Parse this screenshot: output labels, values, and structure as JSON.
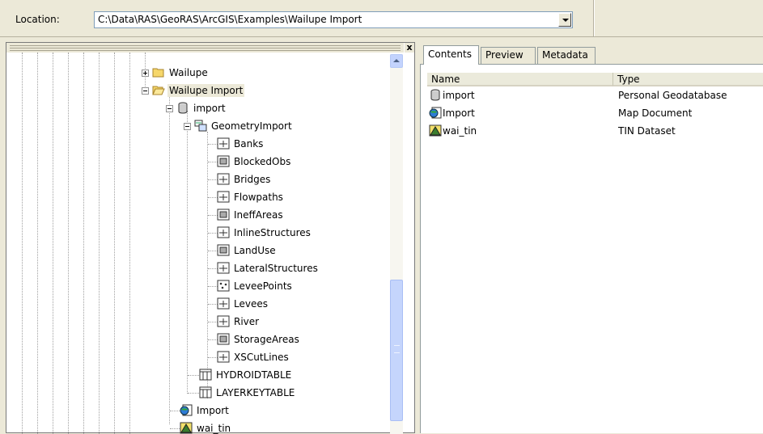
{
  "location": {
    "label": "Location:",
    "value": "C:\\Data\\RAS\\GeoRAS\\ArcGIS\\Examples\\Wailupe Import"
  },
  "tree": {
    "close_symbol": "x",
    "nodes": [
      {
        "label": "Wailupe",
        "icon": "folder-icon"
      },
      {
        "label": "Wailupe Import",
        "icon": "folder-open-icon"
      },
      {
        "label": "import",
        "icon": "geodatabase-icon"
      },
      {
        "label": "GeometryImport",
        "icon": "feature-dataset-icon"
      },
      {
        "label": "Banks",
        "icon": "line-feature-class-icon"
      },
      {
        "label": "BlockedObs",
        "icon": "polygon-feature-class-icon"
      },
      {
        "label": "Bridges",
        "icon": "line-feature-class-icon"
      },
      {
        "label": "Flowpaths",
        "icon": "line-feature-class-icon"
      },
      {
        "label": "IneffAreas",
        "icon": "polygon-feature-class-icon"
      },
      {
        "label": "InlineStructures",
        "icon": "line-feature-class-icon"
      },
      {
        "label": "LandUse",
        "icon": "polygon-feature-class-icon"
      },
      {
        "label": "LateralStructures",
        "icon": "line-feature-class-icon"
      },
      {
        "label": "LeveePoints",
        "icon": "point-feature-class-icon"
      },
      {
        "label": "Levees",
        "icon": "line-feature-class-icon"
      },
      {
        "label": "River",
        "icon": "line-feature-class-icon"
      },
      {
        "label": "StorageAreas",
        "icon": "polygon-feature-class-icon"
      },
      {
        "label": "XSCutLines",
        "icon": "line-feature-class-icon"
      },
      {
        "label": "HYDROIDTABLE",
        "icon": "table-icon"
      },
      {
        "label": "LAYERKEYTABLE",
        "icon": "table-icon"
      },
      {
        "label": "Import",
        "icon": "map-document-icon"
      },
      {
        "label": "wai_tin",
        "icon": "tin-icon"
      }
    ]
  },
  "tabs": [
    "Contents",
    "Preview",
    "Metadata"
  ],
  "contents": {
    "columns": [
      "Name",
      "Type"
    ],
    "rows": [
      {
        "name": "import",
        "type": "Personal Geodatabase",
        "icon": "geodatabase-icon"
      },
      {
        "name": "Import",
        "type": "Map Document",
        "icon": "map-document-icon"
      },
      {
        "name": "wai_tin",
        "type": "TIN Dataset",
        "icon": "tin-icon"
      }
    ]
  }
}
